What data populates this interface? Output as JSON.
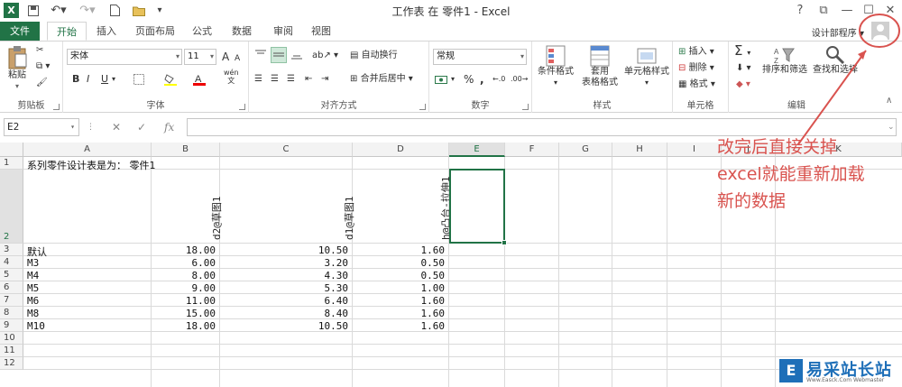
{
  "titlebar": {
    "app_letter": "X",
    "title": "工作表 在 零件1 - Excel",
    "help": "?",
    "restore": "⧉",
    "minimize": "—",
    "maximize": "☐",
    "close": "✕"
  },
  "tabs": [
    "文件",
    "开始",
    "插入",
    "页面布局",
    "公式",
    "数据",
    "审阅",
    "视图"
  ],
  "user": {
    "name": "设计部程序 ▾"
  },
  "ribbon": {
    "clipboard": {
      "paste": "粘贴",
      "label": "剪贴板"
    },
    "font": {
      "name": "宋体",
      "size": "11",
      "bold": "B",
      "italic": "I",
      "underline": "U",
      "label": "字体",
      "grow": "A",
      "shrink": "A",
      "wen": "wén"
    },
    "alignment": {
      "wrap": "自动换行",
      "merge": "合并后居中",
      "label": "对齐方式"
    },
    "number": {
      "format": "常规",
      "percent": "%",
      "comma": ",",
      "label": "数字"
    },
    "styles": {
      "conditional": "条件格式",
      "table1": "套用",
      "table2": "表格格式",
      "cell": "单元格样式",
      "label": "样式"
    },
    "cells": {
      "insert": "插入",
      "delete": "删除",
      "format": "格式",
      "label": "单元格"
    },
    "editing": {
      "sum": "Σ",
      "sort": "排序和筛选",
      "find": "查找和选择",
      "label": "编辑"
    }
  },
  "formula_bar": {
    "namebox": "E2",
    "fx": "fx",
    "cancel": "✕",
    "enter": "✓",
    "value": ""
  },
  "grid": {
    "columns": [
      "A",
      "B",
      "C",
      "D",
      "E",
      "F",
      "G",
      "H",
      "I",
      "J",
      "K"
    ],
    "rows": [
      "1",
      "2",
      "3",
      "4",
      "5",
      "6",
      "7",
      "8",
      "9",
      "10",
      "11",
      "12"
    ],
    "a1": "系列零件设计表是为：  零件1",
    "b2": "d2@草图1",
    "c2": "d1@草图1",
    "d2": "h@凸台-拉伸1",
    "data": [
      [
        "默认",
        "18.00",
        "10.50",
        "1.60"
      ],
      [
        "M3",
        "6.00",
        "3.20",
        "0.50"
      ],
      [
        "M4",
        "8.00",
        "4.30",
        "0.50"
      ],
      [
        "M5",
        "9.00",
        "5.30",
        "1.00"
      ],
      [
        "M6",
        "11.00",
        "6.40",
        "1.60"
      ],
      [
        "M8",
        "15.00",
        "8.40",
        "1.60"
      ],
      [
        "M10",
        "18.00",
        "10.50",
        "1.60"
      ]
    ]
  },
  "annotation": {
    "line1": "改完后直接关掉",
    "line2": "excel就能重新加载",
    "line3": "新的数据",
    "color": "#d9534f"
  },
  "watermark": {
    "logo": "E",
    "text": "易采站长站",
    "sub": "Www.Easck.Com Webmaster"
  },
  "colors": {
    "accent": "#217346"
  }
}
